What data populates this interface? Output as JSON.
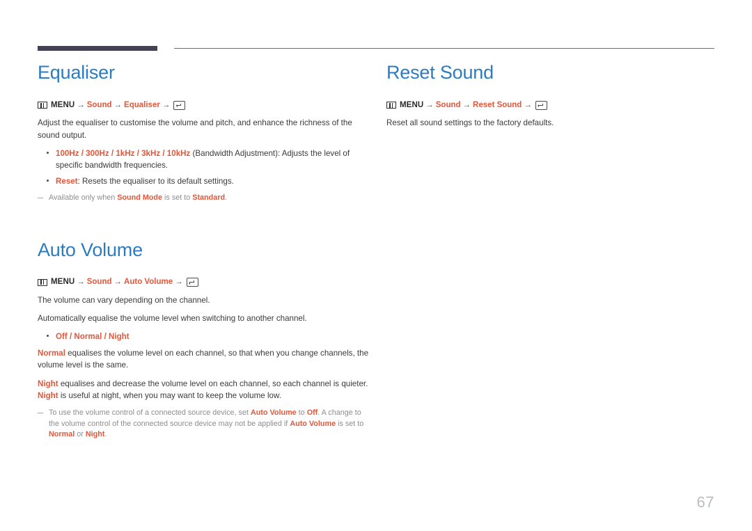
{
  "page": {
    "number": "67"
  },
  "icons": {
    "menu": "menu-grid-icon",
    "enter": "enter-key-icon"
  },
  "colors": {
    "heading": "#2b7cc0",
    "highlight": "#e2573a",
    "rule_dark": "#454154",
    "rule_light": "#6e6e6e",
    "body_text": "#3a3a3a",
    "note_text": "#8e8e8e",
    "page_number": "#b9bcc2"
  },
  "left_column": {
    "sections": [
      {
        "id": "equaliser",
        "title": "Equaliser",
        "menu_path": {
          "menu_label": "MENU",
          "arrow": "→",
          "terms": [
            "Sound",
            "Equaliser"
          ]
        },
        "paragraphs": [
          "Adjust the equaliser to customise the volume and pitch, and enhance the richness of the sound output."
        ],
        "bullets": [
          {
            "highlight": "100Hz / 300Hz / 1kHz / 3kHz / 10kHz",
            "rest": " (Bandwidth Adjustment): Adjusts the level of specific bandwidth frequencies."
          },
          {
            "highlight": "Reset",
            "rest": ": Resets the equaliser to its default settings."
          }
        ],
        "note": {
          "part1": "Available only when ",
          "term1": "Sound Mode",
          "part2": " is set to ",
          "term2": "Standard",
          "part3": "."
        }
      },
      {
        "id": "auto-volume",
        "title": "Auto Volume",
        "menu_path": {
          "menu_label": "MENU",
          "arrow": "→",
          "terms": [
            "Sound",
            "Auto Volume"
          ]
        },
        "paragraphs": [
          "The volume can vary depending on the channel.",
          "Automatically equalise the volume level when switching to another channel."
        ],
        "bullets": [
          {
            "highlight": "Off / Normal / Night",
            "rest": ""
          }
        ],
        "explanations": [
          {
            "term": "Normal",
            "text": " equalises the volume level on each channel, so that when you change channels, the volume level is the same."
          },
          {
            "term": "Night",
            "text": " equalises and decrease the volume level on each channel, so each channel is quieter. ",
            "term2": "Night",
            "text2": " is useful at night, when you may want to keep the volume low."
          }
        ],
        "note_long": {
          "p1": "To use the volume control of a connected source device, set ",
          "t1": "Auto Volume",
          "p2": " to ",
          "t2": "Off",
          "p3": ". A change to the volume control of the connected source device may not be applied if ",
          "t3": "Auto Volume",
          "p4": " is set to ",
          "t4": "Normal",
          "p5": " or ",
          "t5": "Night",
          "p6": "."
        }
      }
    ]
  },
  "right_column": {
    "sections": [
      {
        "id": "reset-sound",
        "title": "Reset Sound",
        "menu_path": {
          "menu_label": "MENU",
          "arrow": "→",
          "terms": [
            "Sound",
            "Reset Sound"
          ]
        },
        "paragraphs": [
          "Reset all sound settings to the factory defaults."
        ]
      }
    ]
  }
}
